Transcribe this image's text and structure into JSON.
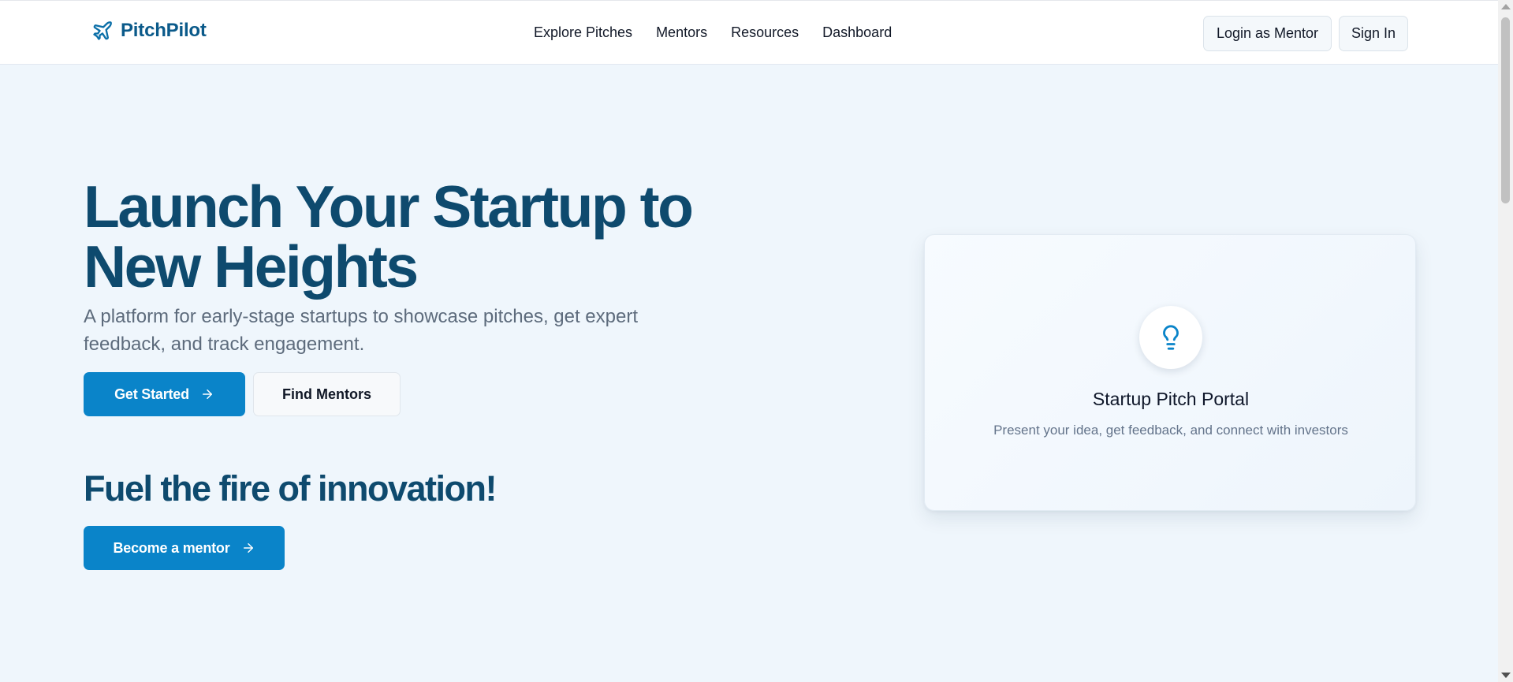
{
  "header": {
    "brand": {
      "name": "PitchPilot",
      "icon": "plane-icon"
    },
    "nav": [
      {
        "label": "Explore Pitches"
      },
      {
        "label": "Mentors"
      },
      {
        "label": "Resources"
      },
      {
        "label": "Dashboard"
      }
    ],
    "login_mentor_label": "Login as Mentor",
    "sign_in_label": "Sign In"
  },
  "hero": {
    "title_line1": "Launch Your Startup to",
    "title_line2": "New Heights",
    "subtitle": "A platform for early-stage startups to showcase pitches, get expert feedback, and track engagement.",
    "get_started_label": "Get Started",
    "find_mentors_label": "Find Mentors",
    "fuel_title": "Fuel the fire of innovation!",
    "become_mentor_label": "Become a mentor"
  },
  "card": {
    "icon": "lightbulb-icon",
    "title": "Startup Pitch Portal",
    "description": "Present your idea, get feedback, and connect with investors"
  },
  "colors": {
    "brand": "#0b5a8a",
    "primary": "#0a84c9",
    "heading": "#0e4a6e",
    "background": "#eff6fc"
  }
}
